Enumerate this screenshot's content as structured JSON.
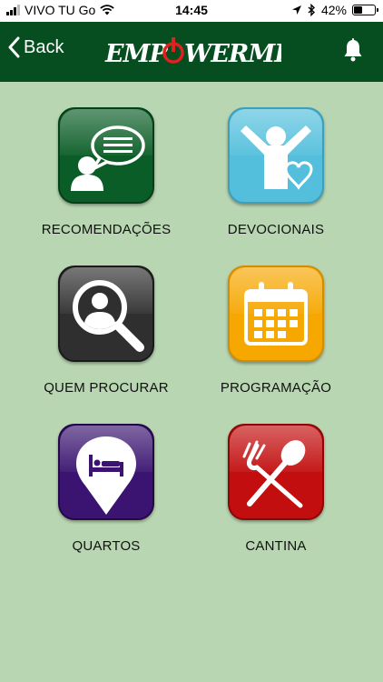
{
  "status": {
    "carrier": "VIVO TU Go",
    "time": "14:45",
    "battery": "42%",
    "battery_level": 0.42
  },
  "nav": {
    "back_label": "Back",
    "logo_text": "EMPOWERMENT",
    "bell_icon": "bell-icon"
  },
  "menu": [
    {
      "label": "RECOMENDAÇÕES",
      "icon": "chat-person-icon",
      "color": "#0a6a2e"
    },
    {
      "label": "DEVOCIONAIS",
      "icon": "worship-heart-icon",
      "color": "#5bc3db"
    },
    {
      "label": "QUEM PROCURAR",
      "icon": "search-person-icon",
      "color": "#333333"
    },
    {
      "label": "PROGRAMAÇÃO",
      "icon": "calendar-icon",
      "color": "#f7a700"
    },
    {
      "label": "QUARTOS",
      "icon": "bed-pin-icon",
      "color": "#3b146e"
    },
    {
      "label": "CANTINA",
      "icon": "fork-spoon-icon",
      "color": "#c40f0f"
    }
  ]
}
